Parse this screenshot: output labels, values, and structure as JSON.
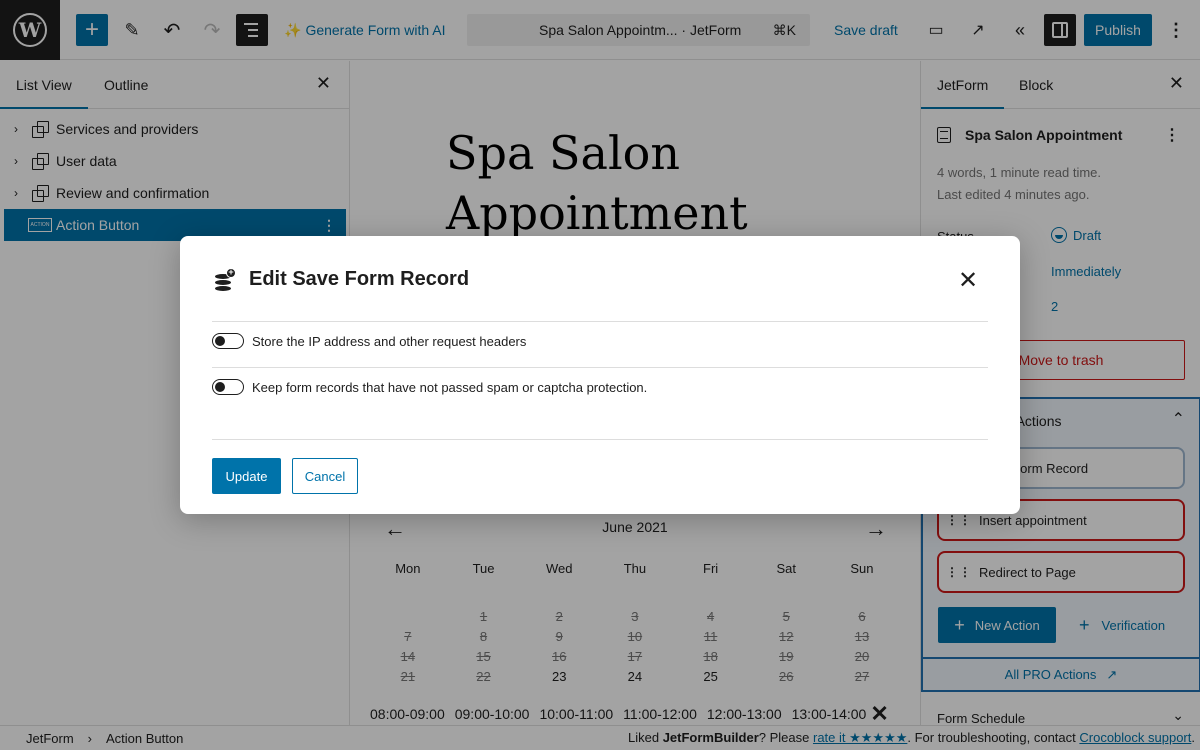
{
  "topbar": {
    "logo": "W",
    "add_icon": "+",
    "edit_icon": "✎",
    "undo_icon": "↶",
    "redo_icon": "↷",
    "ai_icon": "✨",
    "ai_label": "Generate Form with AI",
    "doc_title": "Spa Salon Appointm...  · JetForm",
    "shortcut": "⌘K",
    "save_draft": "Save draft",
    "view_icon": "▭",
    "external_icon": "↗",
    "collapse_icon": "«",
    "publish": "Publish",
    "more_icon": "⋮"
  },
  "left_panel": {
    "tabs": [
      "List View",
      "Outline"
    ],
    "close_icon": "✕",
    "items": [
      {
        "label": "Services and providers",
        "chevron": "›"
      },
      {
        "label": "User data",
        "chevron": "›"
      },
      {
        "label": "Review and confirmation",
        "chevron": "›"
      },
      {
        "label": "Action Button",
        "icon_text": "ACTION",
        "more": "⋮"
      }
    ]
  },
  "canvas": {
    "title_line1": "Spa Salon",
    "title_line2": "Appointment",
    "calendar": {
      "prev_icon": "←",
      "next_icon": "→",
      "month": "June 2021",
      "weekdays": [
        "Mon",
        "Tue",
        "Wed",
        "Thu",
        "Fri",
        "Sat",
        "Sun"
      ],
      "weeks": [
        [
          "",
          "1",
          "2",
          "3",
          "4",
          "5",
          "6"
        ],
        [
          "7",
          "8",
          "9",
          "10",
          "11",
          "12",
          "13"
        ],
        [
          "14",
          "15",
          "16",
          "17",
          "18",
          "19",
          "20"
        ],
        [
          "21",
          "22",
          "23",
          "24",
          "25",
          "26",
          "27"
        ]
      ],
      "available_days": [
        "23",
        "24",
        "25"
      ]
    },
    "time_slots": [
      "08:00-09:00",
      "09:00-10:00",
      "10:00-11:00",
      "11:00-12:00",
      "12:00-13:00",
      "13:00-14:00"
    ],
    "slots_close_icon": "✕"
  },
  "right_panel": {
    "tabs": [
      "JetForm",
      "Block"
    ],
    "close_icon": "✕",
    "doc_title": "Spa Salon Appointment",
    "more_icon": "⋮",
    "meta_words": "4 words, 1 minute read time.",
    "meta_edited": "Last edited 4 minutes ago.",
    "status_label": "Status",
    "status_value": "Draft",
    "publish_value": "Immediately",
    "revisions_value": "2",
    "trash": "Move to trash",
    "actions_title": "Post Submit Actions",
    "actions_toggle_icon": "⌃",
    "actions": [
      {
        "label": "Save Form Record",
        "state": "ok"
      },
      {
        "label": "Insert appointment",
        "state": "error"
      },
      {
        "label": "Redirect to Page",
        "state": "error"
      }
    ],
    "grip_icon": "⋮⋮",
    "new_action": "New Action",
    "verification": "Verification",
    "pro_actions": "All PRO Actions",
    "pro_icon": "↗",
    "schedule": "Form Schedule",
    "schedule_icon": "⌄"
  },
  "footer": {
    "crumbs": [
      "JetForm",
      "Action Button"
    ],
    "crumb_sep": "›",
    "note_prefix": "Liked ",
    "note_brand": "JetFormBuilder",
    "note_mid": "? Please ",
    "rate_link": "rate it ★★★★★",
    "note_after": ". For troubleshooting, contact ",
    "support_link": "Crocoblock support",
    "note_end": "."
  },
  "modal": {
    "title": "Edit Save Form Record",
    "close_icon": "✕",
    "options": [
      {
        "label": "Store the IP address and other request headers",
        "enabled": false
      },
      {
        "label": "Keep form records that have not passed spam or captcha protection.",
        "enabled": false
      }
    ],
    "update": "Update",
    "cancel": "Cancel"
  },
  "colors": {
    "accent": "#0073aa",
    "danger": "#cc1818",
    "dark": "#1e1e1e"
  }
}
